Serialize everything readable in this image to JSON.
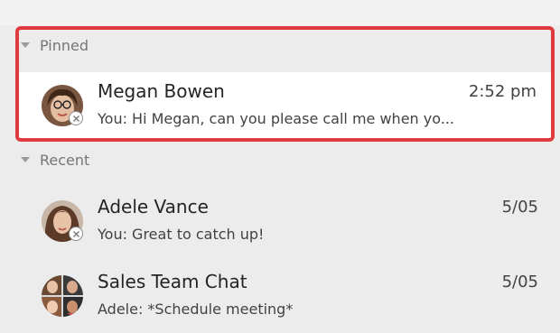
{
  "pinned": {
    "header": "Pinned",
    "items": [
      {
        "name": "Megan Bowen",
        "time": "2:52 pm",
        "preview": "You: Hi Megan, can you please call me when yo..."
      }
    ]
  },
  "recent": {
    "header": "Recent",
    "items": [
      {
        "name": "Adele Vance",
        "time": "5/05",
        "preview": "You: Great to catch up!"
      },
      {
        "name": "Sales Team Chat",
        "time": "5/05",
        "preview": "Adele: *Schedule meeting*"
      }
    ]
  },
  "colors": {
    "highlight": "#e0393e",
    "selected_bg": "#ffffff",
    "list_bg": "#ececec"
  }
}
